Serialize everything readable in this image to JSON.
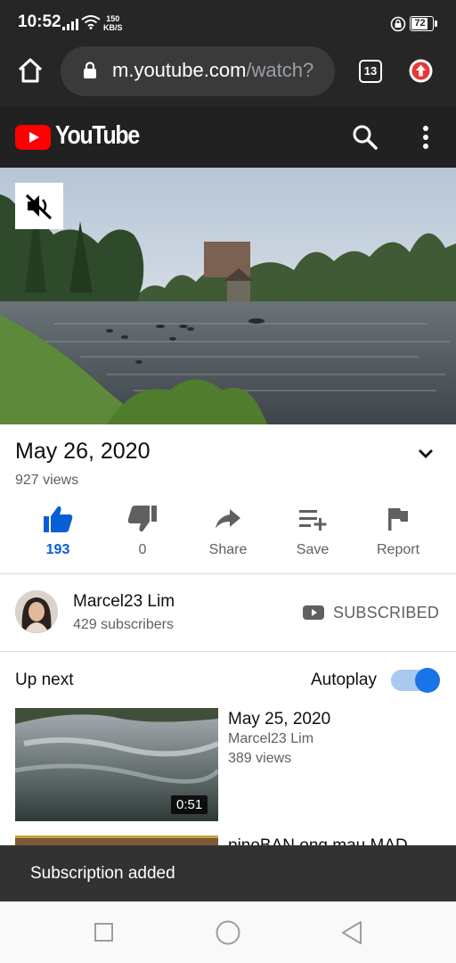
{
  "status_bar": {
    "time": "10:52",
    "net_speed_value": "150",
    "net_speed_unit": "KB/S",
    "battery": "72"
  },
  "browser": {
    "url_main": "m.youtube.com",
    "url_rest": "/watch?",
    "tab_count": "13"
  },
  "youtube_header": {
    "logo_text": "YouTube"
  },
  "video": {
    "date": "May 26, 2020",
    "views": "927 views"
  },
  "actions": [
    {
      "label": "193",
      "icon": "thumbs-up-icon"
    },
    {
      "label": "0",
      "icon": "thumbs-down-icon"
    },
    {
      "label": "Share",
      "icon": "share-icon"
    },
    {
      "label": "Save",
      "icon": "playlist-add-icon"
    },
    {
      "label": "Report",
      "icon": "flag-icon"
    }
  ],
  "channel": {
    "name": "Marcel23 Lim",
    "subscribers": "429 subscribers",
    "subscribe_label": "SUBSCRIBED"
  },
  "up_next": {
    "heading": "Up next",
    "autoplay_label": "Autoplay",
    "autoplay_on": true,
    "items": [
      {
        "title": "May 25, 2020",
        "channel": "Marcel23 Lim",
        "views": "389 views",
        "duration": "0:51"
      },
      {
        "title": "pinoBAN ong mau MAD"
      }
    ]
  },
  "snackbar": {
    "text": "Subscription added"
  },
  "colors": {
    "youtube_red": "#ff0000",
    "accent_blue": "#065fd4",
    "dark_bar": "#262626",
    "toggle_track": "#a9c9f0"
  }
}
